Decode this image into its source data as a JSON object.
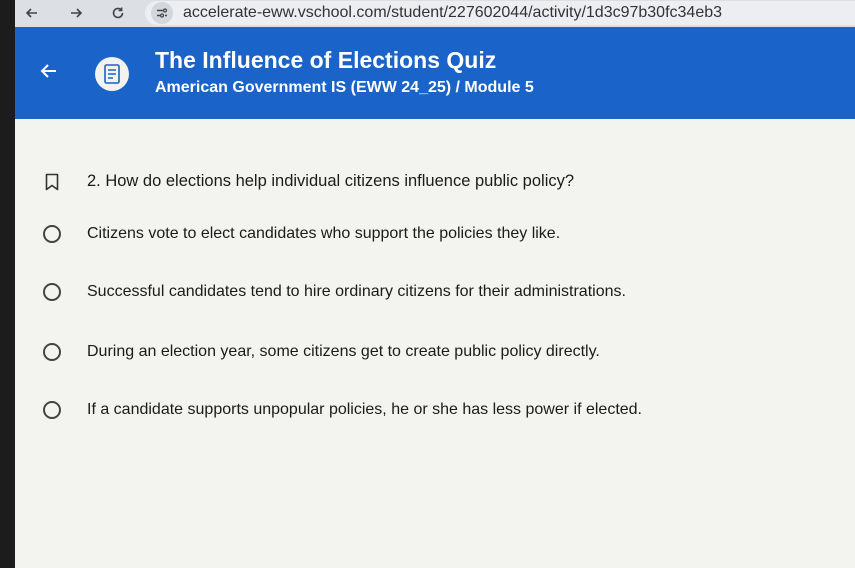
{
  "browser": {
    "url": "accelerate-eww.vschool.com/student/227602044/activity/1d3c97b30fc34eb3",
    "back_icon": "arrow-left-icon",
    "forward_icon": "arrow-right-icon",
    "reload_icon": "reload-icon",
    "site_info_icon": "tune-icon"
  },
  "header": {
    "title": "The Influence of Elections Quiz",
    "subtitle": "American Government IS (EWW 24_25) / Module 5",
    "back_icon": "arrow-left-icon",
    "logo_icon": "document-icon",
    "color": "#1a63c9"
  },
  "question": {
    "text": "2. How do elections help individual citizens influence public policy?",
    "bookmark_icon": "bookmark-icon",
    "options": [
      {
        "label": "Citizens vote to elect candidates who support the policies they like."
      },
      {
        "label": "Successful candidates tend to hire ordinary citizens for their administrations."
      },
      {
        "label": "During an election year, some citizens get to create public policy directly."
      },
      {
        "label": "If a candidate supports unpopular policies, he or she has less power if elected."
      }
    ]
  }
}
